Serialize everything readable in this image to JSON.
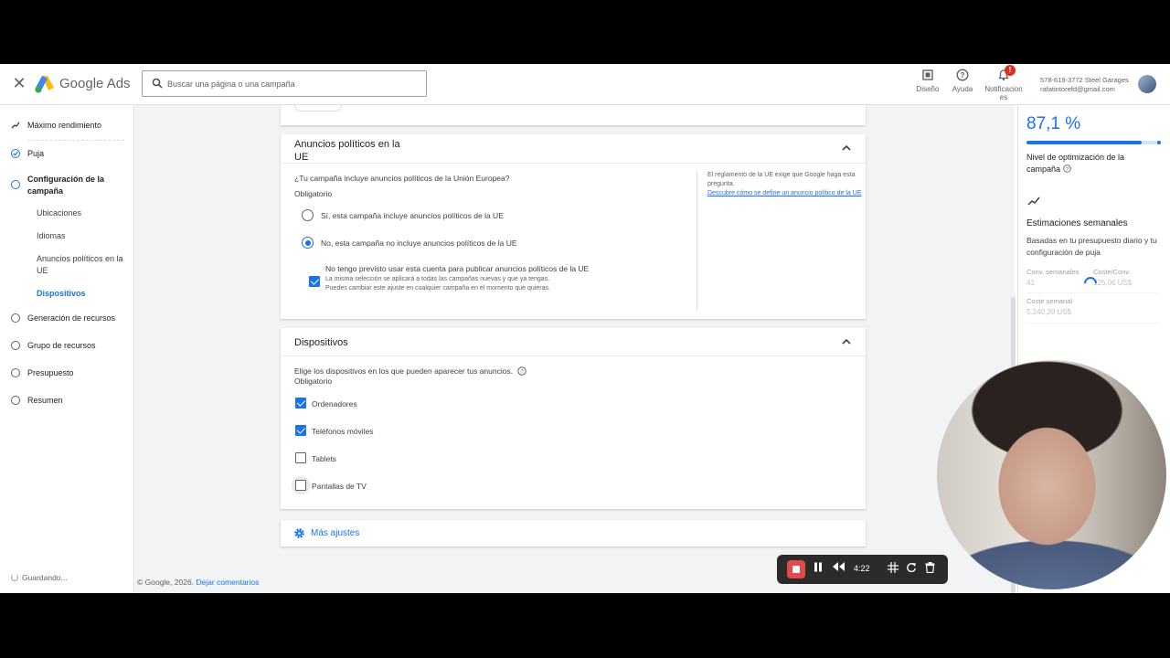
{
  "header": {
    "brand": "Google Ads",
    "search_placeholder": "Buscar una página o una campaña",
    "buttons": [
      {
        "label": "Diseño",
        "icon": "design-icon"
      },
      {
        "label": "Ayuda",
        "icon": "help-icon"
      },
      {
        "label": "Notificaciones",
        "icon": "bell-icon",
        "badge": "!"
      }
    ],
    "account_phone": "578-619-3772 Steel Garages",
    "account_email": "rafatintorefd@gmail.com"
  },
  "nav": {
    "items": [
      {
        "label": "Máximo rendimiento"
      },
      {
        "label": "Puja"
      },
      {
        "label": "Configuración de la campaña"
      },
      {
        "label": "Generación de recursos"
      },
      {
        "label": "Grupo de recursos"
      },
      {
        "label": "Presupuesto"
      },
      {
        "label": "Resumen"
      }
    ],
    "sub_items": [
      {
        "label": "Ubicaciones"
      },
      {
        "label": "Idiomas"
      },
      {
        "label": "Anuncios políticos en la UE"
      },
      {
        "label": "Dispositivos"
      }
    ],
    "status": "Guardando..."
  },
  "political": {
    "title": "Anuncios políticos en la UE",
    "question": "¿Tu campaña incluye anuncios políticos de la Unión Europea?",
    "required": "Obligatorio",
    "option_yes": "Sí, esta campaña incluye anuncios políticos de la UE",
    "option_no": "No, esta campaña no incluye anuncios políticos de la UE",
    "checkbox_title": "No tengo previsto usar esta cuenta para publicar anuncios políticos de la UE",
    "checkbox_desc": "La misma selección se aplicará a todas las campañas nuevas y que ya tengas. Puedes cambiar este ajuste en cualquier campaña en el momento que quieras.",
    "note": "El reglamento de la UE exige que Google haga esta pregunta.",
    "note_link": "Descubre cómo se define un anuncio político de la UE"
  },
  "devices": {
    "title": "Dispositivos",
    "question": "Elige los dispositivos en los que pueden aparecer tus anuncios.",
    "required": "Obligatorio",
    "options": [
      {
        "label": "Ordenadores",
        "checked": true
      },
      {
        "label": "Teléfonos móviles",
        "checked": true
      },
      {
        "label": "Tablets",
        "checked": false
      },
      {
        "label": "Pantallas de TV",
        "checked": false
      }
    ]
  },
  "more_settings": "Más ajustes",
  "footer": {
    "copyright": "© Google, 2026.",
    "feedback": "Dejar comentarios"
  },
  "right_panel": {
    "score": "87,1 %",
    "score_fraction": 0.871,
    "score_label": "Nivel de optimización de la campaña",
    "weekly_title": "Estimaciones semanales",
    "weekly_desc": "Basadas en tu presupuesto diario y tu configuración de puja",
    "conv_label": "Conv. semanales",
    "conv_value": "41",
    "cost_conv_label": "Coste/Conv.",
    "cost_conv_value": "125,06 US$",
    "cost_week_label": "Coste semanal",
    "cost_week_value": "5.240,20 US$"
  },
  "recorder": {
    "time": "4:22"
  },
  "colors": {
    "accent": "#1a73e8",
    "record": "#e5484d"
  }
}
